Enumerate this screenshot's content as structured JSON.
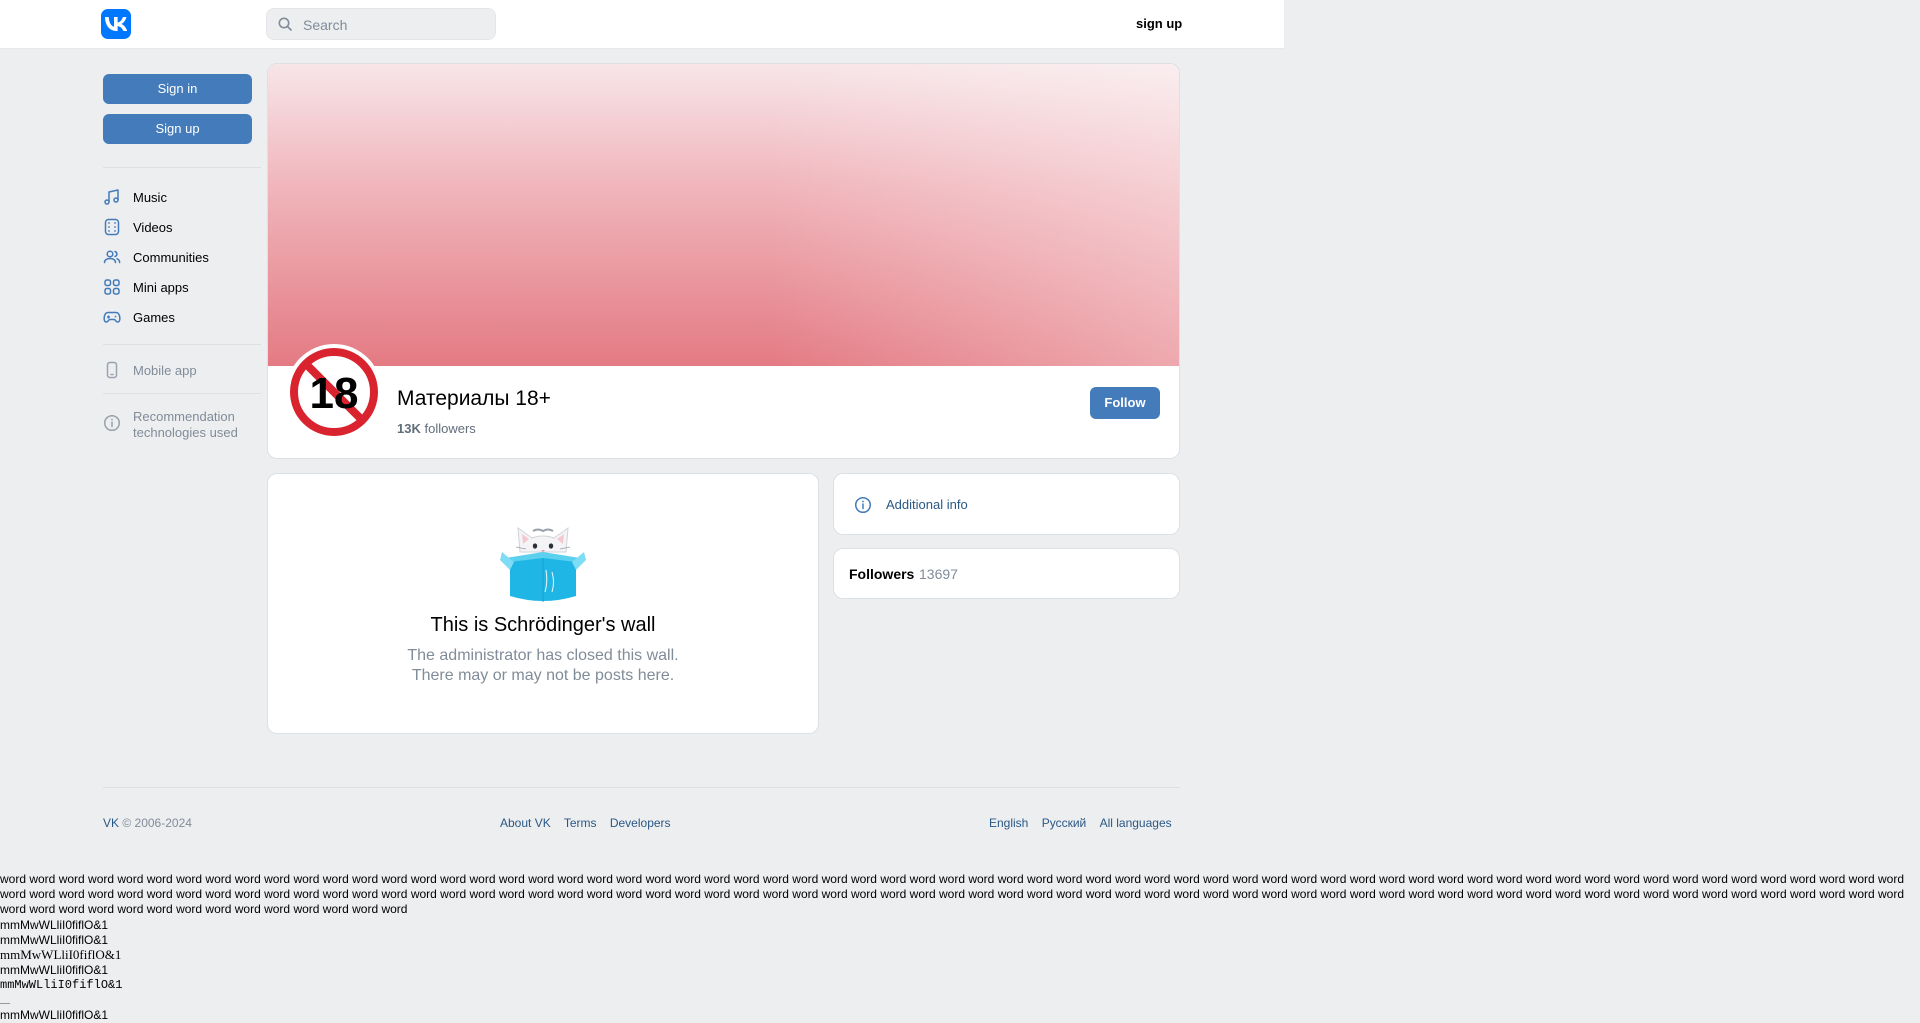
{
  "header": {
    "logo_alt": "VK",
    "search_placeholder": "Search",
    "signup_label": "sign up"
  },
  "sidebar": {
    "sign_in_label": "Sign in",
    "sign_up_label": "Sign up",
    "items": [
      {
        "label": "Music",
        "icon": "music-note-icon"
      },
      {
        "label": "Videos",
        "icon": "video-icon"
      },
      {
        "label": "Communities",
        "icon": "users-icon"
      },
      {
        "label": "Mini apps",
        "icon": "grid-apps-icon"
      },
      {
        "label": "Games",
        "icon": "gamepad-icon"
      }
    ],
    "mobile_app_label": "Mobile app",
    "recommendation_label_line1": "Recommendation",
    "recommendation_label_line2": "technologies used"
  },
  "community": {
    "name": "Материалы 18+",
    "followers_short": "13K",
    "followers_word": "followers",
    "follow_label": "Follow",
    "avatar_text": "18"
  },
  "wall": {
    "title": "This is Schrödinger's wall",
    "desc_line1": "The administrator has closed this wall.",
    "desc_line2": "There may or may not be posts here."
  },
  "info": {
    "additional_info_label": "Additional info",
    "followers_title": "Followers",
    "followers_count": "13697"
  },
  "footer": {
    "brand": "VK",
    "copyright": "© 2006-2024",
    "links": [
      "About VK",
      "Terms",
      "Developers"
    ],
    "languages": [
      "English",
      "Русский",
      "All languages"
    ]
  },
  "debug": {
    "words_line": "word word word word word word word word word word word word word word word word word word word word word word word word word word word word word word word word word word word word word word word word word word word word word word word word word word word word word word word word word word word word word word word word word word word word word word word word word word word word word word word word word word word word word word word word word word word word word word word word word word word word word word word word word word word word word word word word word word word word word word word word word word word word word word word word word word word word word word word word word word word word word word word word",
    "probe_text": "mmMwWLliI0fiflO&1"
  },
  "colors": {
    "accent": "#447bba",
    "vk_blue": "#0077ff",
    "link": "#2a5885",
    "background": "#edeef0"
  }
}
